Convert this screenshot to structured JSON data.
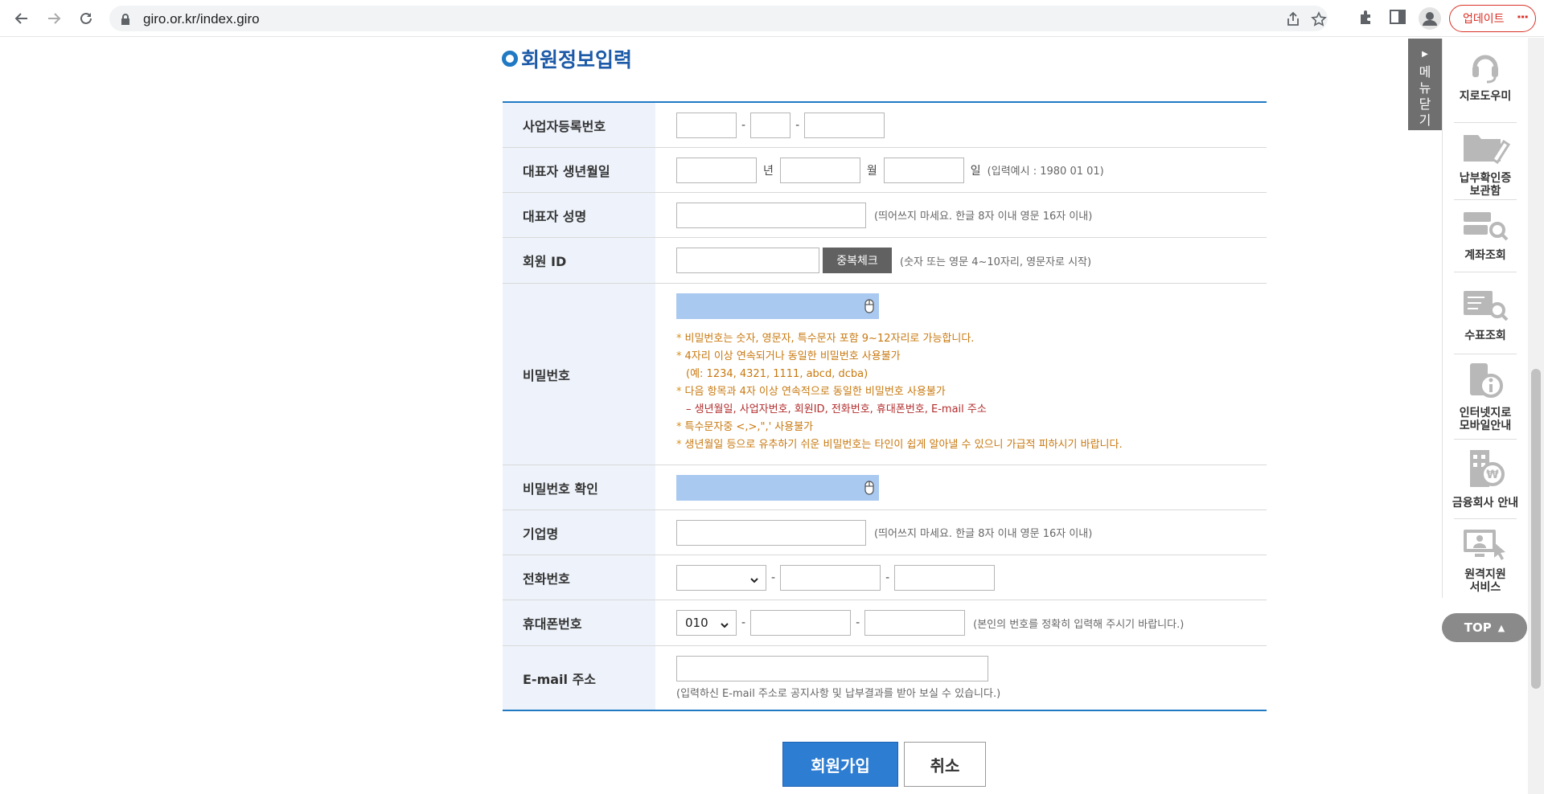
{
  "browser": {
    "url": "giro.or.kr/index.giro",
    "update_label": "업데이트"
  },
  "page": {
    "section_title": "회원정보입력"
  },
  "form": {
    "business_no": {
      "label": "사업자등록번호"
    },
    "birth": {
      "label": "대표자 생년월일",
      "year_unit": "년",
      "month_unit": "월",
      "day_unit": "일",
      "hint": "(입력예시 : 1980 01 01)"
    },
    "rep_name": {
      "label": "대표자 성명",
      "hint": "(띄어쓰지 마세요. 한글 8자 이내 영문 16자 이내)"
    },
    "member_id": {
      "label": "회원 ID",
      "check_button": "중복체크",
      "hint": "(숫자 또는 영문 4~10자리, 영문자로 시작)"
    },
    "password": {
      "label": "비밀번호",
      "rules": [
        "비밀번호는 숫자, 영문자, 특수문자 포함 9~12자리로 가능합니다.",
        "4자리 이상 연속되거나 동일한 비밀번호 사용불가",
        "(예: 1234, 4321, 1111, abcd, dcba)",
        "다음 항목과 4자 이상 연속적으로 동일한 비밀번호 사용불가",
        "– 생년월일, 사업자번호, 회원ID, 전화번호, 휴대폰번호, E-mail 주소",
        "특수문자중 <,>,\",' 사용불가",
        "생년월일 등으로 유추하기 쉬운 비밀번호는 타인이 쉽게 알아낼 수 있으니 가급적 피하시기 바랍니다."
      ]
    },
    "password_confirm": {
      "label": "비밀번호 확인"
    },
    "company": {
      "label": "기업명",
      "hint": "(띄어쓰지 마세요. 한글 8자 이내 영문 16자 이내)"
    },
    "phone": {
      "label": "전화번호",
      "area_selected": ""
    },
    "mobile": {
      "label": "휴대폰번호",
      "prefix_selected": "010",
      "hint": "(본인의 번호를 정확히 입력해 주시기 바랍니다.)"
    },
    "email": {
      "label": "E-mail 주소",
      "hint": "(입력하신 E-mail 주소로 공지사항 및 납부결과를 받아 보실 수 있습니다.)"
    }
  },
  "buttons": {
    "join": "회원가입",
    "cancel": "취소"
  },
  "quick_menu": {
    "close_label": [
      "메",
      "뉴",
      "닫",
      "기"
    ],
    "items": [
      {
        "label": "지로도우미",
        "icon": "headset-icon"
      },
      {
        "label": "납부확인증\n보관함",
        "icon": "folder-icon"
      },
      {
        "label": "계좌조회",
        "icon": "account-search-icon"
      },
      {
        "label": "수표조회",
        "icon": "check-search-icon"
      },
      {
        "label": "인터넷지로\n모바일안내",
        "icon": "mobile-info-icon"
      },
      {
        "label": "금융회사 안내",
        "icon": "bank-icon"
      },
      {
        "label": "원격지원\n서비스",
        "icon": "remote-support-icon"
      }
    ],
    "top_label": "TOP"
  }
}
